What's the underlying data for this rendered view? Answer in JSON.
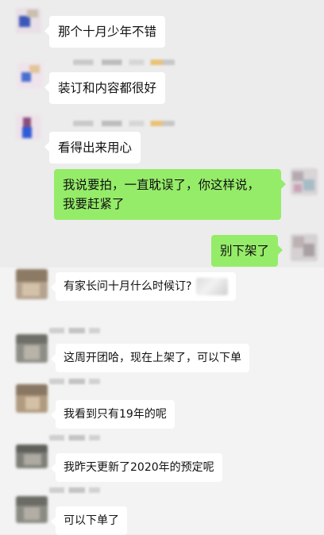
{
  "top_chat": {
    "messages": [
      {
        "side": "left",
        "text": "那个十月少年不错"
      },
      {
        "side": "left",
        "text": "装订和内容都很好"
      },
      {
        "side": "left",
        "text": "看得出来用心"
      },
      {
        "side": "right",
        "lines": [
          "我说要拍，一直耽误了，你这样说，",
          "我要赶紧了"
        ]
      },
      {
        "side": "right",
        "text": "别下架了"
      }
    ]
  },
  "bottom_chat": {
    "messages": [
      {
        "side": "left",
        "text": "有家长问十月什么时候订?"
      },
      {
        "side": "left",
        "text": "这周开团哈，现在上架了，可以下单"
      },
      {
        "side": "left",
        "text": "我看到只有19年的呢"
      },
      {
        "side": "left",
        "text": "我昨天更新了2020年的预定呢"
      },
      {
        "side": "left",
        "text": "可以下单了"
      }
    ]
  },
  "icons": {
    "avatar": "blurred-avatar-icon",
    "sticker": "blurred-emoji-sticker-icon"
  },
  "colors": {
    "sent_bubble": "#95ec69",
    "received_bubble": "#ffffff",
    "background": "#ededed"
  }
}
